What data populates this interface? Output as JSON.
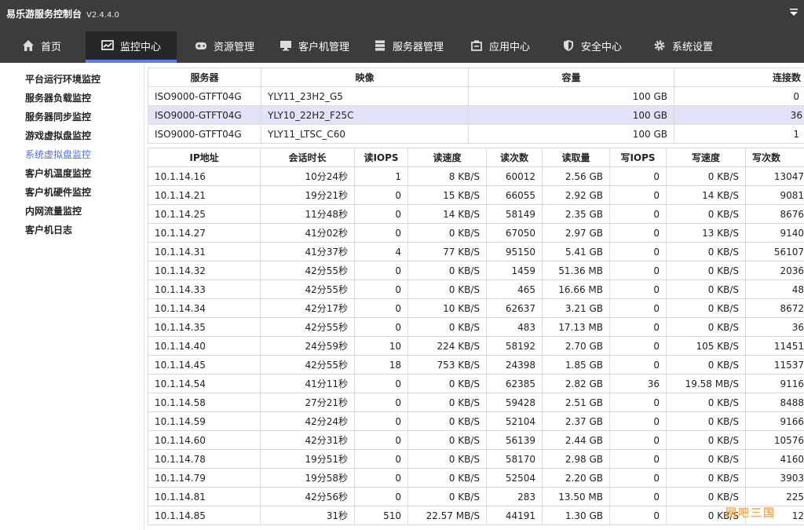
{
  "window": {
    "title": "易乐游服务控制台",
    "version": "V2.4.4.0"
  },
  "nav": {
    "tabs": [
      {
        "label": "首页",
        "icon": "home-icon"
      },
      {
        "label": "监控中心",
        "icon": "monitor-chart-icon",
        "active": true
      },
      {
        "label": "资源管理",
        "icon": "gamepad-icon"
      },
      {
        "label": "客户机管理",
        "icon": "desktop-icon"
      },
      {
        "label": "服务器管理",
        "icon": "server-icon"
      },
      {
        "label": "应用中心",
        "icon": "app-box-icon"
      },
      {
        "label": "安全中心",
        "icon": "shield-icon"
      },
      {
        "label": "系统设置",
        "icon": "gear-icon"
      }
    ],
    "active_color": "#5b7ef2"
  },
  "sidebar": {
    "items": [
      {
        "label": "平台运行环境监控"
      },
      {
        "label": "服务器负载监控"
      },
      {
        "label": "服务器同步监控"
      },
      {
        "label": "游戏虚拟盘监控"
      },
      {
        "label": "系统虚拟盘监控",
        "active": true
      },
      {
        "label": "客户机温度监控"
      },
      {
        "label": "客户机硬件监控"
      },
      {
        "label": "内网流量监控"
      },
      {
        "label": "客户机日志"
      }
    ]
  },
  "server_table": {
    "headers": [
      "服务器",
      "映像",
      "容量",
      "连接数"
    ],
    "rows": [
      {
        "server": "ISO9000-GTFT04G",
        "image": "YLY11_23H2_G5",
        "capacity": "100 GB",
        "connections": "0"
      },
      {
        "server": "ISO9000-GTFT04G",
        "image": "YLY10_22H2_F25C",
        "capacity": "100 GB",
        "connections": "36",
        "selected": true
      },
      {
        "server": "ISO9000-GTFT04G",
        "image": "YLY11_LTSC_C60",
        "capacity": "100 GB",
        "connections": "1"
      }
    ]
  },
  "session_table": {
    "headers": [
      "IP地址",
      "会话时长",
      "读IOPS",
      "读速度",
      "读次数",
      "读取量",
      "写IOPS",
      "写速度",
      "写次数"
    ],
    "rows": [
      [
        "10.1.14.16",
        "10分24秒",
        "1",
        "8 KB/S",
        "60012",
        "2.56 GB",
        "0",
        "0 KB/S",
        "13047"
      ],
      [
        "10.1.14.21",
        "19分21秒",
        "0",
        "15 KB/S",
        "66055",
        "2.92 GB",
        "0",
        "14 KB/S",
        "9081"
      ],
      [
        "10.1.14.25",
        "11分48秒",
        "0",
        "14 KB/S",
        "58149",
        "2.35 GB",
        "0",
        "0 KB/S",
        "8676"
      ],
      [
        "10.1.14.27",
        "41分02秒",
        "0",
        "0 KB/S",
        "67050",
        "2.97 GB",
        "0",
        "13 KB/S",
        "9140"
      ],
      [
        "10.1.14.31",
        "41分37秒",
        "4",
        "77 KB/S",
        "95150",
        "5.41 GB",
        "0",
        "0 KB/S",
        "56107"
      ],
      [
        "10.1.14.32",
        "42分55秒",
        "0",
        "0 KB/S",
        "1459",
        "51.36 MB",
        "0",
        "0 KB/S",
        "2036"
      ],
      [
        "10.1.14.33",
        "42分55秒",
        "0",
        "0 KB/S",
        "465",
        "16.66 MB",
        "0",
        "0 KB/S",
        "48"
      ],
      [
        "10.1.14.34",
        "42分17秒",
        "0",
        "10 KB/S",
        "62637",
        "3.21 GB",
        "0",
        "0 KB/S",
        "8672"
      ],
      [
        "10.1.14.35",
        "42分55秒",
        "0",
        "0 KB/S",
        "483",
        "17.13 MB",
        "0",
        "0 KB/S",
        "36"
      ],
      [
        "10.1.14.40",
        "24分59秒",
        "10",
        "224 KB/S",
        "58192",
        "2.70 GB",
        "0",
        "105 KB/S",
        "11451"
      ],
      [
        "10.1.14.45",
        "42分55秒",
        "18",
        "753 KB/S",
        "24398",
        "1.85 GB",
        "0",
        "0 KB/S",
        "11537"
      ],
      [
        "10.1.14.54",
        "41分11秒",
        "0",
        "0 KB/S",
        "62385",
        "2.82 GB",
        "36",
        "19.58 MB/S",
        "9116"
      ],
      [
        "10.1.14.58",
        "27分21秒",
        "0",
        "0 KB/S",
        "59428",
        "2.51 GB",
        "0",
        "0 KB/S",
        "8488"
      ],
      [
        "10.1.14.59",
        "42分24秒",
        "0",
        "0 KB/S",
        "52104",
        "2.37 GB",
        "0",
        "0 KB/S",
        "9166"
      ],
      [
        "10.1.14.60",
        "42分31秒",
        "0",
        "0 KB/S",
        "56139",
        "2.44 GB",
        "0",
        "0 KB/S",
        "10576"
      ],
      [
        "10.1.14.78",
        "19分51秒",
        "0",
        "0 KB/S",
        "58170",
        "2.98 GB",
        "0",
        "0 KB/S",
        "4160"
      ],
      [
        "10.1.14.79",
        "19分58秒",
        "0",
        "0 KB/S",
        "52504",
        "2.20 GB",
        "0",
        "0 KB/S",
        "3903"
      ],
      [
        "10.1.14.81",
        "42分56秒",
        "0",
        "0 KB/S",
        "283",
        "13.50 MB",
        "0",
        "0 KB/S",
        "225"
      ],
      [
        "10.1.14.85",
        "31秒",
        "510",
        "22.57 MB/S",
        "44191",
        "1.30 GB",
        "0",
        "0 KB/S",
        "12"
      ]
    ]
  },
  "watermark": "网吧三国"
}
